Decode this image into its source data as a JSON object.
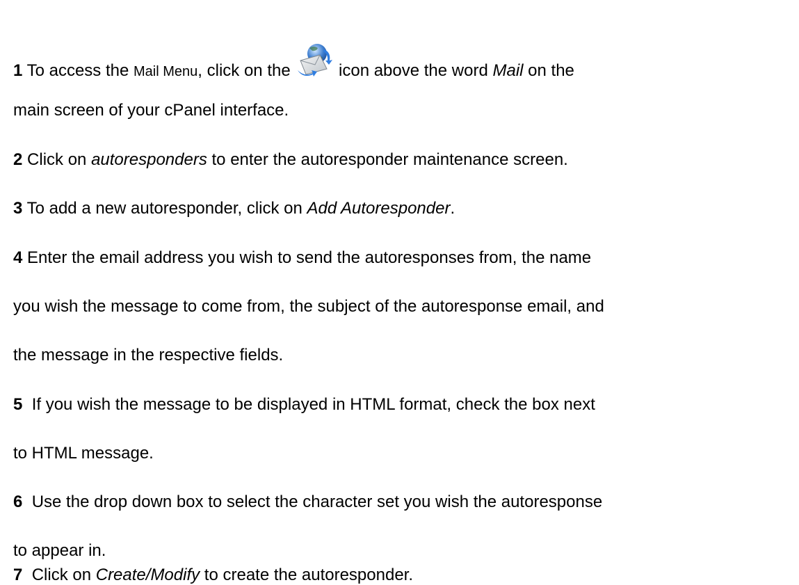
{
  "steps": [
    {
      "num": "1",
      "parts": {
        "a": " To access the ",
        "b": "Mail Menu",
        "c": ", click on the ",
        "d": " icon above the word ",
        "e": "Mail",
        "f": " on the"
      },
      "cont": "main screen of your cPanel interface."
    },
    {
      "num": "2",
      "parts": {
        "a": " Click on ",
        "b": "autoresponders",
        "c": " to enter the autoresponder maintenance screen."
      }
    },
    {
      "num": "3",
      "parts": {
        "a": " To add a new autoresponder, click on ",
        "b": "Add Autoresponder",
        "c": "."
      }
    },
    {
      "num": "4",
      "lines": [
        "Enter the email address you wish to send the autoresponses from, the name",
        "you wish the message to come from, the subject of the autoresponse email, and",
        "the message in the respective fields."
      ]
    },
    {
      "num": "5",
      "lines": [
        "If you wish the message to be displayed in HTML format, check the box next",
        "to HTML message."
      ]
    },
    {
      "num": "6",
      "lines": [
        "Use the drop down box to select the character set you wish the autoresponse",
        "to appear in."
      ]
    },
    {
      "num": "7",
      "parts": {
        "a": "  Click on ",
        "b": "Create/Modify",
        "c": " to create the autoresponder."
      }
    }
  ],
  "icons": {
    "mail": "mail-icon"
  }
}
